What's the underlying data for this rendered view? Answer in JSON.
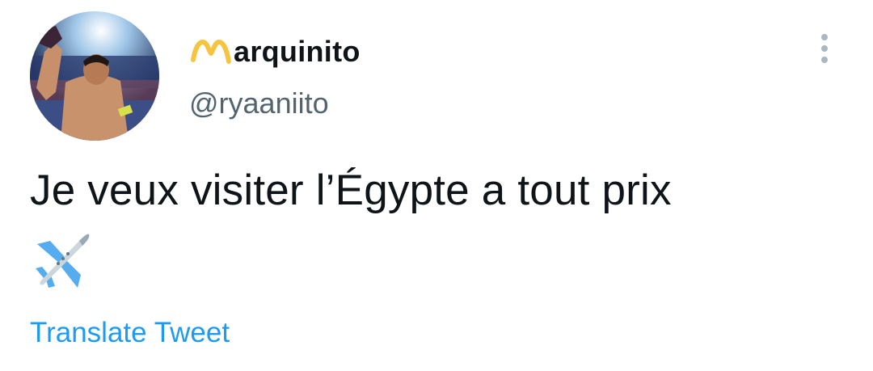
{
  "tweet": {
    "display_name": "arquinito",
    "handle": "@ryaaniito",
    "text": "Je veux visiter l’Égypte a tout prix",
    "emoji": "airplane-icon",
    "translate_label": "Translate Tweet"
  },
  "colors": {
    "name_badge_m": "#f5c542",
    "handle": "#536471",
    "link": "#1d9bf0",
    "more_dots": "#aab8c2"
  }
}
